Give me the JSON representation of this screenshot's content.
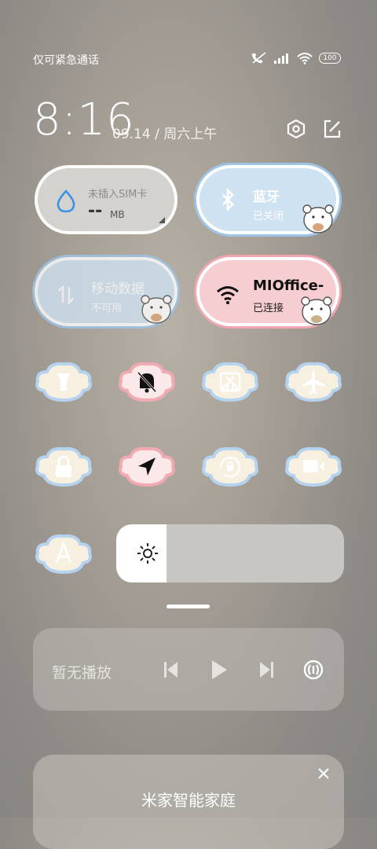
{
  "status_bar": {
    "carrier_text": "仅可紧急通话",
    "battery": "100",
    "icons": [
      "no-sim-call-icon",
      "signal-icon",
      "wifi-icon",
      "battery-icon"
    ]
  },
  "header": {
    "time": "8:16",
    "date": "09.14 / 周六上午",
    "settings_icon": "gear-hex-icon",
    "edit_icon": "edit-icon"
  },
  "tiles": {
    "data_usage": {
      "title": "未插入SIM卡",
      "value": "-- ",
      "unit": "MB",
      "icon": "drop-icon"
    },
    "bluetooth": {
      "title": "蓝牙",
      "status": "已关闭",
      "icon": "bluetooth-icon"
    },
    "mobile_data": {
      "title": "移动数据",
      "status": "不可用",
      "icon": "data-arrows-icon"
    },
    "wifi": {
      "title": "MIOffice-",
      "status": "已连接",
      "icon": "wifi-icon"
    }
  },
  "toggles": [
    {
      "name": "flashlight",
      "icon": "flashlight-icon",
      "active": false
    },
    {
      "name": "mute",
      "icon": "bell-off-icon",
      "active": true
    },
    {
      "name": "screenshot",
      "icon": "scissors-icon",
      "active": false
    },
    {
      "name": "airplane",
      "icon": "airplane-icon",
      "active": false
    },
    {
      "name": "lock",
      "icon": "lock-icon",
      "active": false
    },
    {
      "name": "location",
      "icon": "location-arrow-icon",
      "active": true
    },
    {
      "name": "rotation-lock",
      "icon": "rotation-lock-icon",
      "active": false
    },
    {
      "name": "screen-record",
      "icon": "video-icon",
      "active": false
    },
    {
      "name": "font",
      "icon": "font-a-icon",
      "active": false
    }
  ],
  "brightness": {
    "level": 0.22,
    "icon": "sun-icon"
  },
  "media": {
    "status": "暂无播放",
    "icons": [
      "previous-icon",
      "play-icon",
      "next-icon",
      "cast-icon"
    ]
  },
  "mijia": {
    "title": "米家智能家庭",
    "close_icon": "close-icon"
  },
  "colors": {
    "blue_tile": "#cfe2f2",
    "blue_border": "#9ec4e8",
    "pink_tile": "#f6cdd0",
    "pink_border": "#f1a5ae",
    "gray_tile": "#d3d2cf"
  }
}
